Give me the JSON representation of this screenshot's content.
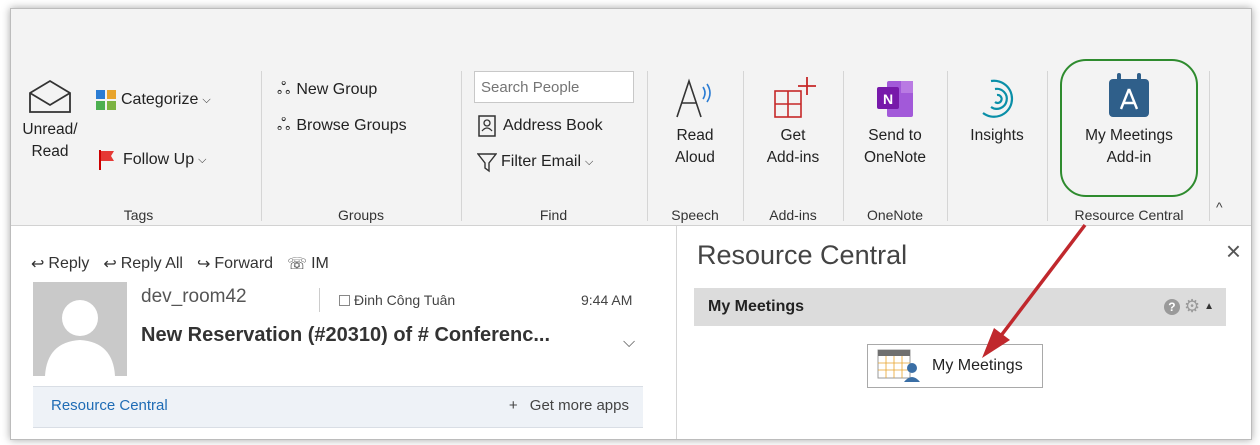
{
  "ribbon": {
    "tags": {
      "unread_read_label": "Unread/\nRead",
      "categorize_label": "Categorize",
      "follow_up_label": "Follow Up",
      "group_label": "Tags"
    },
    "groups": {
      "new_group_label": "New Group",
      "browse_groups_label": "Browse Groups",
      "group_label": "Groups"
    },
    "find": {
      "search_placeholder": "Search People",
      "address_book_label": "Address Book",
      "filter_email_label": "Filter Email",
      "group_label": "Find"
    },
    "speech": {
      "read_aloud_label": "Read\nAloud",
      "group_label": "Speech"
    },
    "addins": {
      "get_addins_label": "Get\nAdd-ins",
      "group_label": "Add-ins"
    },
    "onenote": {
      "send_label": "Send to\nOneNote",
      "group_label": "OneNote"
    },
    "insights": {
      "label": "Insights"
    },
    "resource_central": {
      "my_meetings_label": "My Meetings\nAdd-in",
      "group_label": "Resource Central"
    }
  },
  "mail": {
    "actions": {
      "reply": "Reply",
      "reply_all": "Reply All",
      "forward": "Forward",
      "im": "IM"
    },
    "sender": "dev_room42",
    "recipient": "Đinh Công Tuân",
    "time": "9:44 AM",
    "subject": "New Reservation (#20310) of # Conferenc...",
    "addin_bar": {
      "name": "Resource Central",
      "get_more": "Get more apps"
    }
  },
  "pane": {
    "title": "Resource Central",
    "section_title": "My Meetings",
    "tile_label": "My Meetings"
  },
  "colors": {
    "highlight": "#2e8b2e",
    "arrow": "#c0282d",
    "link": "#1f6cb5",
    "onenote": "#7719aa",
    "addin_icon": "#2f5f8a"
  }
}
